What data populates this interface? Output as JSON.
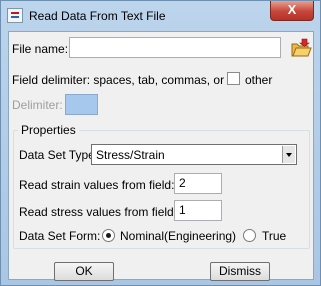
{
  "window": {
    "title": "Read Data From Text File",
    "close_symbol": "X",
    "app_icon": "app-icon"
  },
  "file": {
    "label": "File name:",
    "value": "",
    "browse_icon": "folder-open-icon"
  },
  "delimiter": {
    "field_label": "Field delimiter: spaces, tab, commas, or",
    "other_label": "other",
    "other_checked": false,
    "delimiter_label": "Delimiter:",
    "delimiter_value": ""
  },
  "properties": {
    "group_title": "Properties",
    "data_set_type_label": "Data Set Type:",
    "data_set_type_value": "Stress/Strain",
    "strain_label": "Read strain values from field:",
    "strain_value": "2",
    "stress_label": "Read stress values from field:",
    "stress_value": "1",
    "form_label": "Data Set Form:",
    "form_options": [
      "Nominal(Engineering)",
      "True"
    ],
    "form_selected": "Nominal(Engineering)"
  },
  "buttons": {
    "ok": "OK",
    "dismiss": "Dismiss"
  }
}
